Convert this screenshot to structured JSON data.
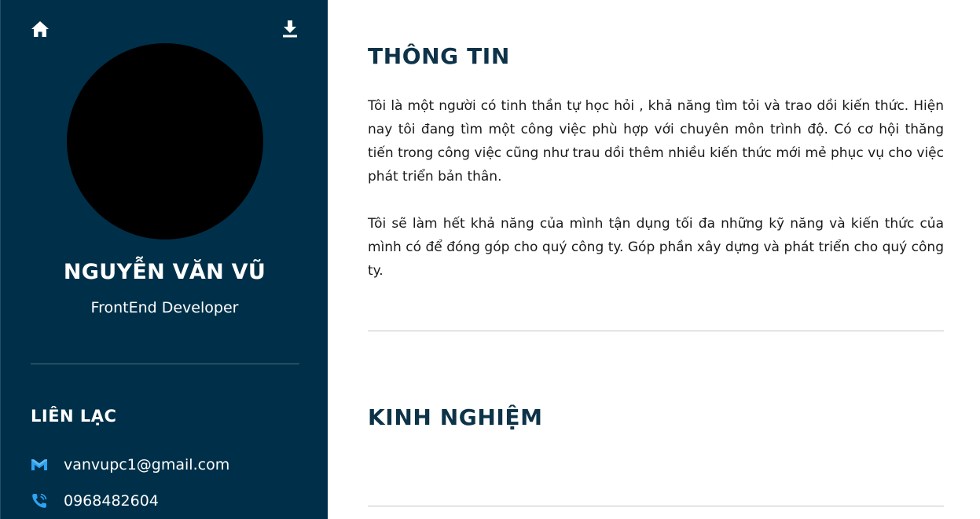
{
  "sidebar": {
    "name": "NGUYỄN VĂN VŨ",
    "role": "FrontEnd Developer",
    "contact": {
      "title": "LIÊN LẠC",
      "email": "vanvupc1@gmail.com",
      "phone": "0968482604"
    },
    "icons": {
      "home": "home-icon",
      "download": "download-icon",
      "email": "gmail-icon",
      "phone": "phone-icon"
    }
  },
  "main": {
    "info": {
      "title": "THÔNG TIN",
      "paragraphs": [
        "Tôi là một người có tinh thần tự học hỏi , khả năng tìm tỏi và trao dồi kiến thức. Hiện nay tôi đang tìm một công việc phù hợp với chuyên môn trình độ. Có cơ hội thăng tiến trong công việc cũng như trau dồi thêm nhiều kiến thức mới mẻ phục vụ cho việc phát triển bản thân.",
        "Tôi sẽ làm hết khả năng của mình tận dụng tối đa những kỹ năng và kiến thức của mình có để đóng góp cho quý công ty. Góp phần xây dựng và phát triển cho quý công ty."
      ]
    },
    "experience": {
      "title": "KINH NGHIỆM"
    }
  },
  "colors": {
    "sidebar_bg": "#003049",
    "heading": "#0d3349",
    "contact_icon": "#2ea3f2"
  }
}
